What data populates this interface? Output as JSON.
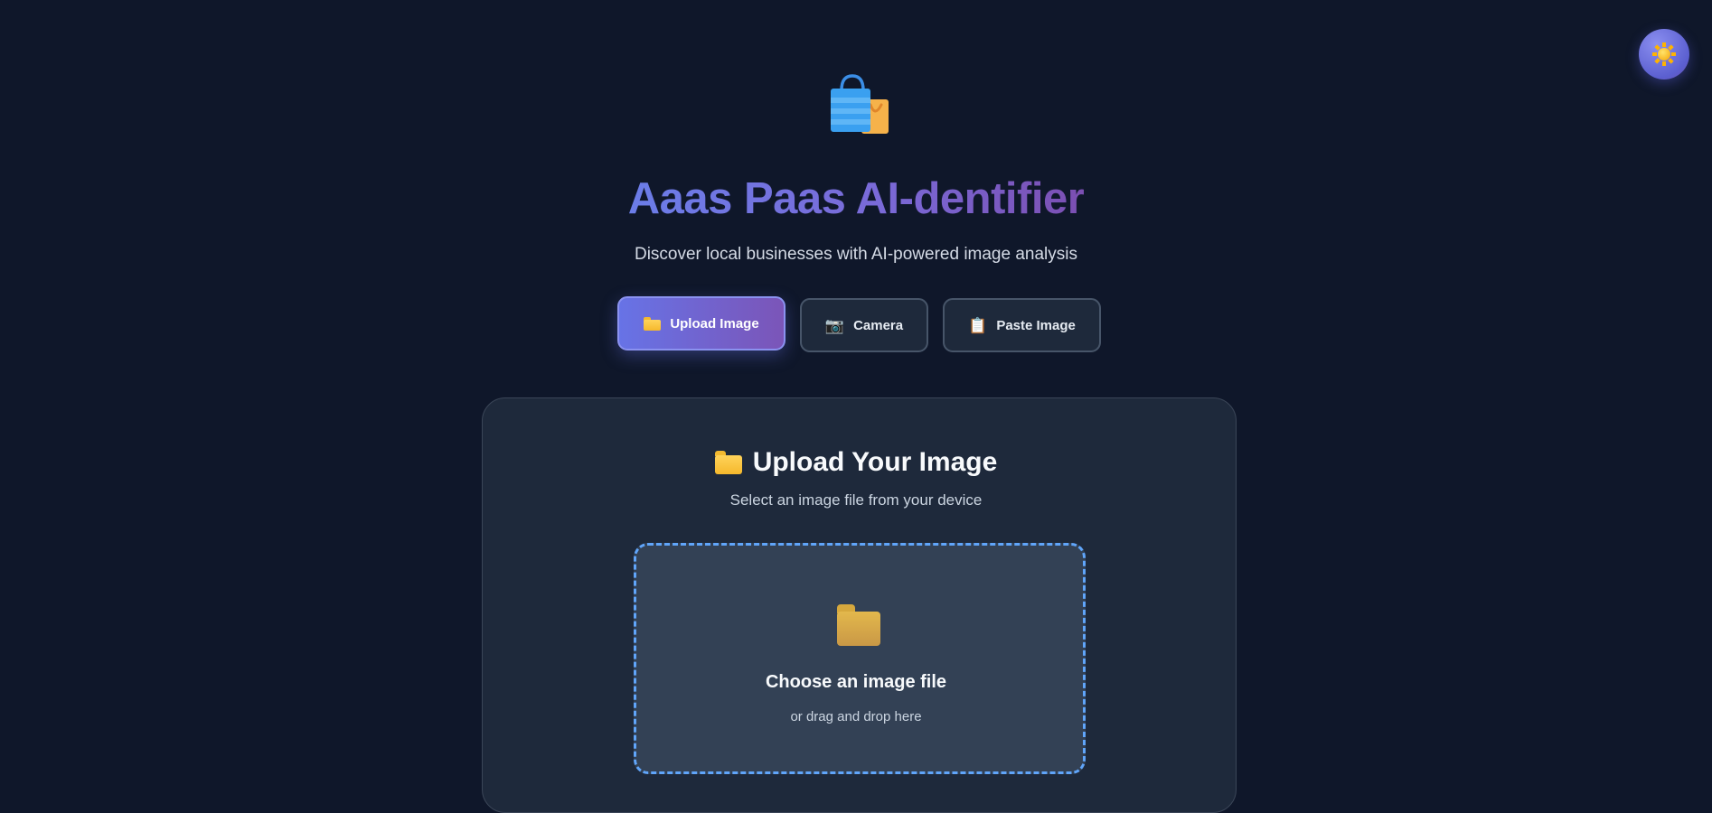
{
  "header": {
    "logo_icon": "shopping-bags-icon",
    "title": "Aaas Paas AI-dentifier",
    "subtitle": "Discover local businesses with AI-powered image analysis"
  },
  "theme_toggle": {
    "icon": "sun-icon"
  },
  "modes": [
    {
      "label": "Upload Image",
      "icon": "folder-icon",
      "active": true
    },
    {
      "label": "Camera",
      "icon": "camera-icon",
      "active": false
    },
    {
      "label": "Paste Image",
      "icon": "clipboard-icon",
      "active": false
    }
  ],
  "upload_card": {
    "title": "Upload Your Image",
    "subtitle": "Select an image file from your device",
    "dropzone": {
      "icon": "folder-icon",
      "title": "Choose an image file",
      "subtitle": "or drag and drop here"
    }
  },
  "colors": {
    "background": "#0f172a",
    "card": "#1e293b",
    "accent_start": "#6773e6",
    "accent_end": "#7b55b8",
    "dropzone_border": "#60a5fa"
  }
}
